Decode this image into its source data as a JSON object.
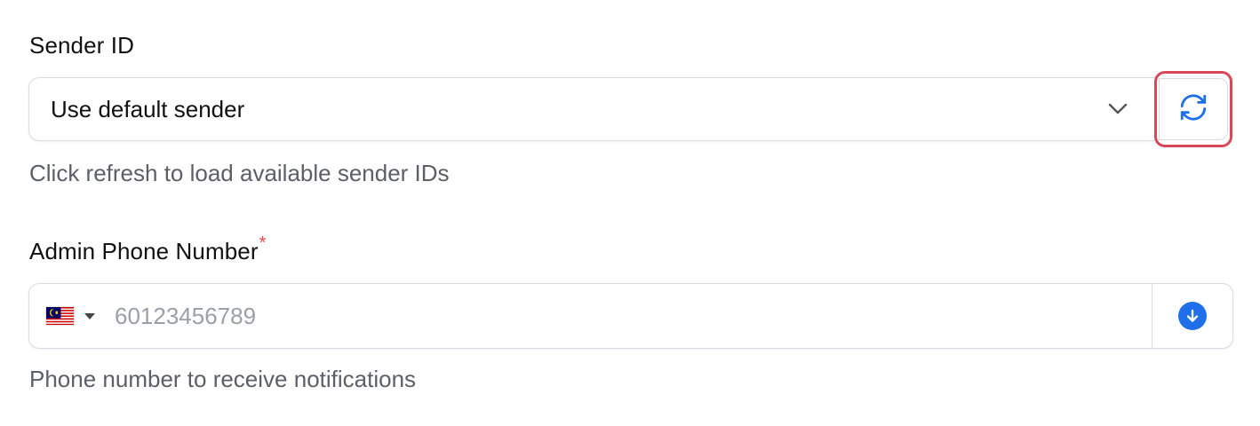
{
  "sender": {
    "label": "Sender ID",
    "selected_value": "Use default sender",
    "help_text": "Click refresh to load available sender IDs",
    "refresh_icon": "refresh-icon",
    "chevron_icon": "chevron-down-icon"
  },
  "phone": {
    "label": "Admin Phone Number",
    "required_mark": "*",
    "placeholder": "60123456789",
    "value": "",
    "country_flag": "malaysia-flag-icon",
    "help_text": "Phone number to receive notifications",
    "action_icon": "arrow-down-circle-icon"
  },
  "colors": {
    "accent": "#1f6feb",
    "highlight_border": "#d9475a",
    "required": "#e5484d",
    "help_text": "#5b5f66"
  }
}
